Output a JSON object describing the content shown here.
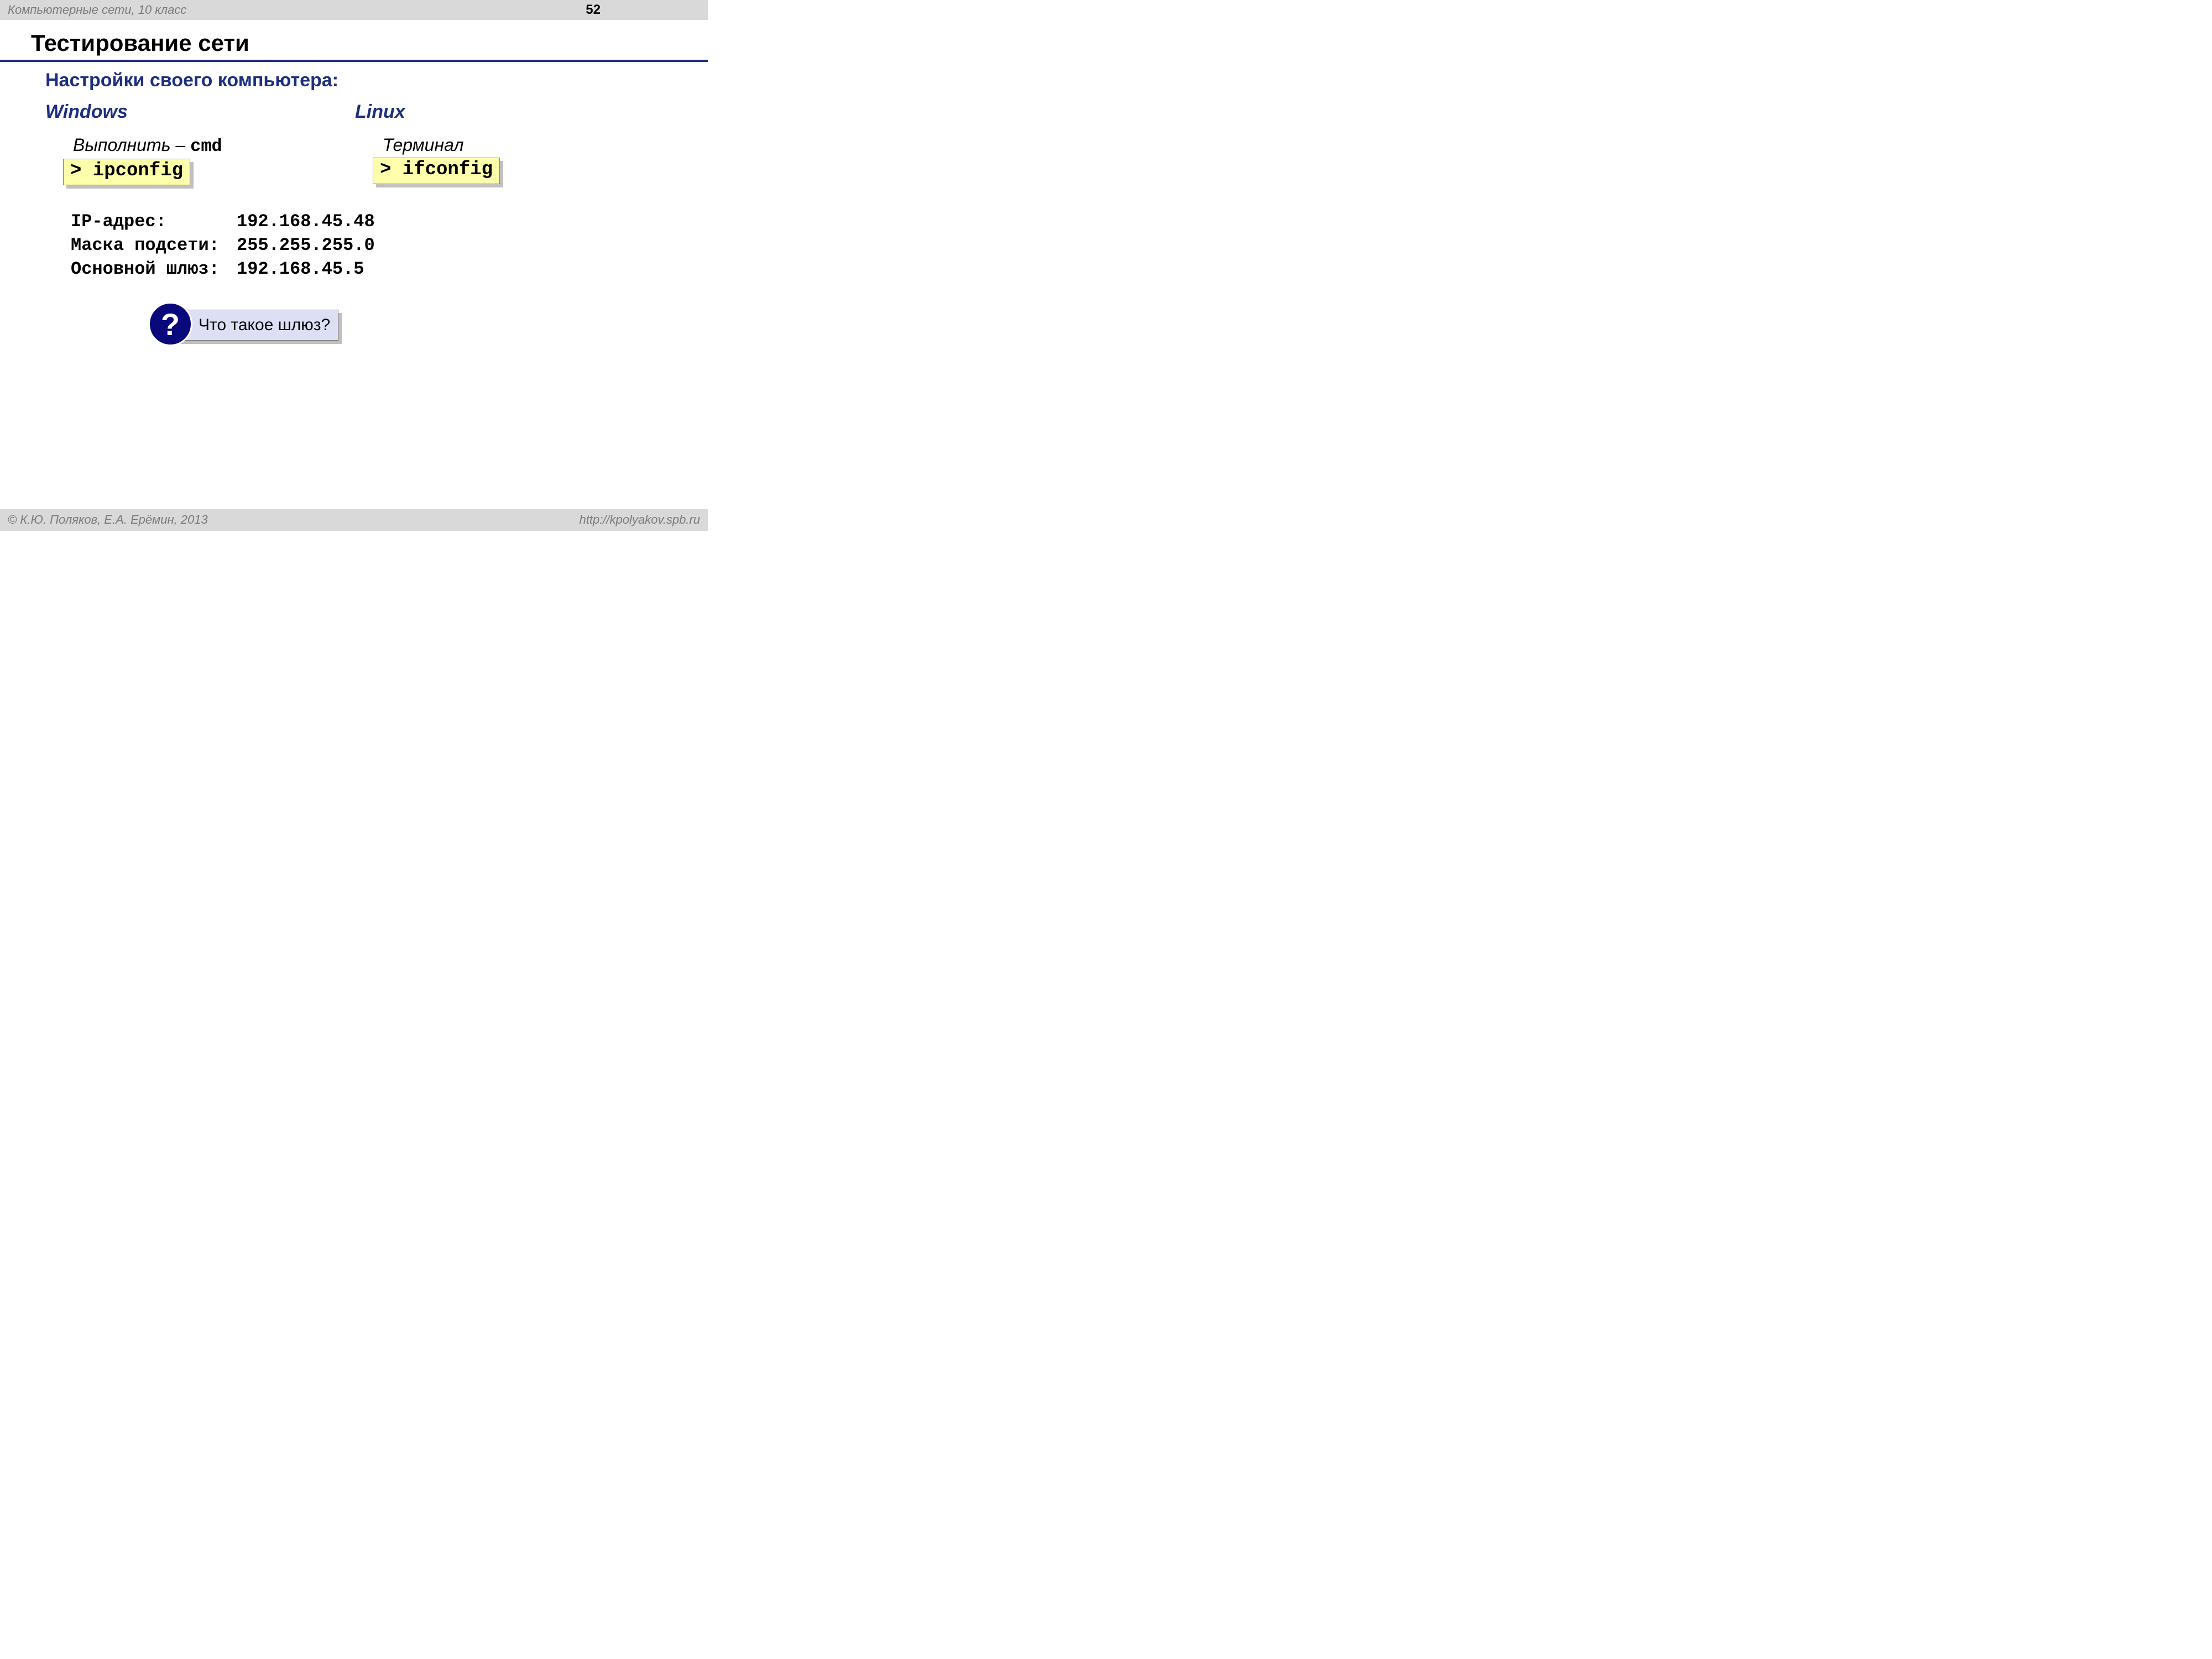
{
  "header": {
    "course": "Компьютерные сети, 10 класс",
    "page": "52"
  },
  "title": "Тестирование сети",
  "subtitle": "Настройки своего компьютера:",
  "windows": {
    "heading": "Windows",
    "step_prefix": "Выполнить – ",
    "step_cmd": "cmd",
    "command": "> ipconfig"
  },
  "linux": {
    "heading": "Linux",
    "step": "Терминал",
    "command": "> ifconfig"
  },
  "output": {
    "ip_label": "IP-адрес:",
    "ip_value": "192.168.45.48",
    "mask_label": "Маска подсети:",
    "mask_value": "255.255.255.0",
    "gw_label": "Основной шлюз:",
    "gw_value": "192.168.45.5"
  },
  "callout": {
    "icon": "?",
    "text": "Что такое шлюз?"
  },
  "footer": {
    "left": "© К.Ю. Поляков, Е.А. Ерёмин, 2013",
    "right": "http://kpolyakov.spb.ru"
  }
}
